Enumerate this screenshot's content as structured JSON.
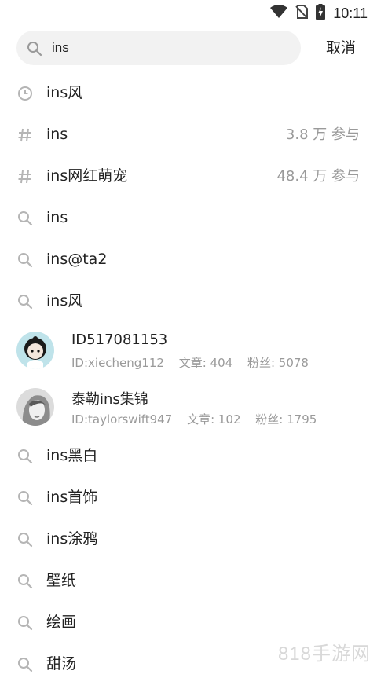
{
  "status_bar": {
    "time": "10:11"
  },
  "search": {
    "query": "ins",
    "cancel_label": "取消"
  },
  "results": [
    {
      "icon": "history-clock-icon",
      "label": "ins风",
      "meta": ""
    },
    {
      "icon": "hashtag-icon",
      "label": "ins",
      "meta": "3.8 万 参与"
    },
    {
      "icon": "hashtag-icon",
      "label": "ins网红萌宠",
      "meta": "48.4 万 参与"
    },
    {
      "icon": "search-icon",
      "label": "ins",
      "meta": ""
    },
    {
      "icon": "search-icon",
      "label": "ins@ta2",
      "meta": ""
    },
    {
      "icon": "search-icon",
      "label": "ins风",
      "meta": ""
    }
  ],
  "users": [
    {
      "name": "ID517081153",
      "id_text": "ID:xiecheng112",
      "articles": "文章: 404",
      "fans": "粉丝: 5078"
    },
    {
      "name": "泰勒ins集锦",
      "id_text": "ID:taylorswift947",
      "articles": "文章: 102",
      "fans": "粉丝: 1795"
    }
  ],
  "suggestions": [
    {
      "icon": "search-icon",
      "label": "ins黑白"
    },
    {
      "icon": "search-icon",
      "label": "ins首饰"
    },
    {
      "icon": "search-icon",
      "label": "ins涂鸦"
    },
    {
      "icon": "search-icon",
      "label": "壁纸"
    },
    {
      "icon": "search-icon",
      "label": "绘画"
    },
    {
      "icon": "search-icon",
      "label": "甜汤"
    }
  ],
  "watermark": "818手游网"
}
